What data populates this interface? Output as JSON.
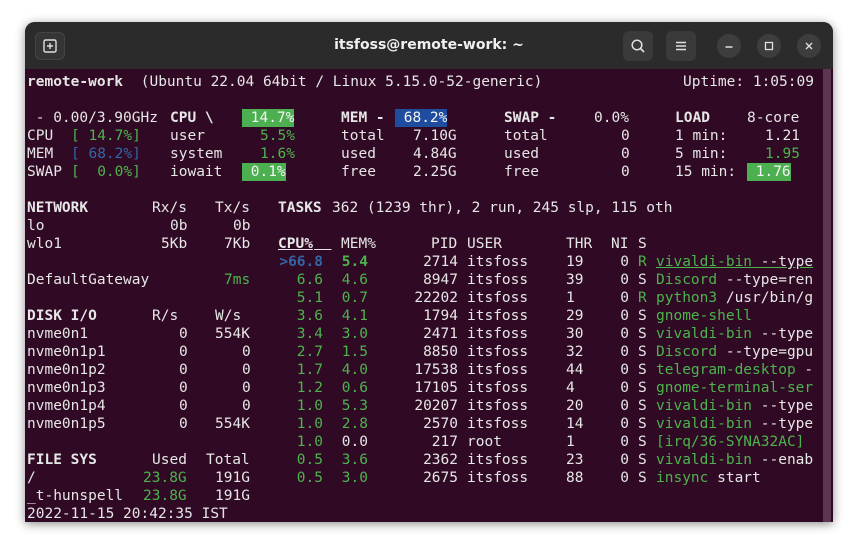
{
  "window": {
    "title": "itsfoss@remote-work: ~"
  },
  "header": {
    "host": "remote-work",
    "os": " (Ubuntu 22.04 64bit / Linux 5.15.0-52-generic)",
    "uptime": "Uptime: 1:05:09"
  },
  "quicklook": {
    "freq": " - 0.00/3.90GHz",
    "cpu_label": "CPU",
    "cpu_val": "[ 14.7%]",
    "mem_label": "MEM",
    "mem_val": "[ 68.2%]",
    "swap_label": "SWAP",
    "swap_val": "[  0.0%]"
  },
  "cpu": {
    "title": "CPU \\",
    "pct": " 14.7%",
    "user_label": "user",
    "user": "5.5%",
    "system_label": "system",
    "system": "1.6%",
    "iowait_label": "iowait",
    "iowait": " 0.1%"
  },
  "mem": {
    "title": "MEM -",
    "pct": " 68.2%",
    "total_label": "total",
    "total": "7.10G",
    "used_label": "used",
    "used": "4.84G",
    "free_label": "free",
    "free": "2.25G"
  },
  "swap": {
    "title": "SWAP -",
    "pct": "0.0%",
    "total_label": "total",
    "total": "0",
    "used_label": "used",
    "used": "0",
    "free_label": "free",
    "free": "0"
  },
  "load": {
    "title": "LOAD",
    "cores": "8-core",
    "m1_label": "1 min:",
    "m1": "1.21",
    "m5_label": "5 min:",
    "m5": "1.95",
    "m15_label": "15 min:",
    "m15": " 1.76"
  },
  "network": {
    "title": "NETWORK",
    "rx_h": "Rx/s",
    "tx_h": "Tx/s",
    "rows": [
      {
        "name": "lo",
        "rx": "0b",
        "tx": "0b"
      },
      {
        "name": "wlo1",
        "rx": "5Kb",
        "tx": "7Kb"
      }
    ],
    "gw_label": "DefaultGateway",
    "gw_val": "7ms"
  },
  "diskio": {
    "title": "DISK I/O",
    "r_h": "R/s",
    "w_h": "W/s",
    "rows": [
      {
        "name": "nvme0n1",
        "r": "0",
        "w": "554K"
      },
      {
        "name": "nvme0n1p1",
        "r": "0",
        "w": "0"
      },
      {
        "name": "nvme0n1p2",
        "r": "0",
        "w": "0"
      },
      {
        "name": "nvme0n1p3",
        "r": "0",
        "w": "0"
      },
      {
        "name": "nvme0n1p4",
        "r": "0",
        "w": "0"
      },
      {
        "name": "nvme0n1p5",
        "r": "0",
        "w": "554K"
      }
    ]
  },
  "fs": {
    "title": "FILE SYS",
    "used_h": "Used",
    "total_h": "Total",
    "rows": [
      {
        "name": "/",
        "used": "23.8G",
        "total": "191G"
      },
      {
        "name": "_t-hunspell",
        "used": "23.8G",
        "total": "191G"
      }
    ]
  },
  "datetime": "2022-11-15 20:42:35 IST",
  "tasks": {
    "label": "TASKS",
    "summary": "362 (1239 thr), 2 run, 245 slp, 115 oth"
  },
  "proc_headers": {
    "cpu": "CPU%",
    "mem": "MEM%",
    "pid": "PID",
    "user": "USER",
    "thr": "THR",
    "ni": "NI",
    "s": "S"
  },
  "processes": [
    {
      "cpu": ">66.8",
      "mem": "5.4",
      "pid": "2714",
      "user": "itsfoss",
      "thr": "19",
      "ni": "0",
      "s": "R",
      "cmd": "vivaldi-bin",
      "args": " --type"
    },
    {
      "cpu": "6.6",
      "mem": "4.6",
      "pid": "8947",
      "user": "itsfoss",
      "thr": "39",
      "ni": "0",
      "s": "S",
      "cmd": "Discord",
      "args": " --type=ren"
    },
    {
      "cpu": "5.1",
      "mem": "0.7",
      "pid": "22202",
      "user": "itsfoss",
      "thr": "1",
      "ni": "0",
      "s": "R",
      "cmd": "python3",
      "args": " /usr/bin/g"
    },
    {
      "cpu": "3.6",
      "mem": "4.1",
      "pid": "1794",
      "user": "itsfoss",
      "thr": "29",
      "ni": "0",
      "s": "S",
      "cmd": "gnome-shell",
      "args": ""
    },
    {
      "cpu": "3.4",
      "mem": "3.0",
      "pid": "2471",
      "user": "itsfoss",
      "thr": "30",
      "ni": "0",
      "s": "S",
      "cmd": "vivaldi-bin",
      "args": " --type"
    },
    {
      "cpu": "2.7",
      "mem": "1.5",
      "pid": "8850",
      "user": "itsfoss",
      "thr": "32",
      "ni": "0",
      "s": "S",
      "cmd": "Discord",
      "args": " --type=gpu"
    },
    {
      "cpu": "1.7",
      "mem": "4.0",
      "pid": "17538",
      "user": "itsfoss",
      "thr": "44",
      "ni": "0",
      "s": "S",
      "cmd": "telegram-desktop",
      "args": " -"
    },
    {
      "cpu": "1.2",
      "mem": "0.6",
      "pid": "17105",
      "user": "itsfoss",
      "thr": "4",
      "ni": "0",
      "s": "S",
      "cmd": "gnome-terminal-ser",
      "args": ""
    },
    {
      "cpu": "1.0",
      "mem": "5.3",
      "pid": "20207",
      "user": "itsfoss",
      "thr": "20",
      "ni": "0",
      "s": "S",
      "cmd": "vivaldi-bin",
      "args": " --type"
    },
    {
      "cpu": "1.0",
      "mem": "2.8",
      "pid": "2570",
      "user": "itsfoss",
      "thr": "14",
      "ni": "0",
      "s": "S",
      "cmd": "vivaldi-bin",
      "args": " --type"
    },
    {
      "cpu": "1.0",
      "mem": "0.0",
      "pid": "217",
      "user": "root",
      "thr": "1",
      "ni": "0",
      "s": "S",
      "cmd": "[irq/36-SYNA32AC]",
      "args": ""
    },
    {
      "cpu": "0.5",
      "mem": "3.6",
      "pid": "2362",
      "user": "itsfoss",
      "thr": "23",
      "ni": "0",
      "s": "S",
      "cmd": "vivaldi-bin",
      "args": " --enab"
    },
    {
      "cpu": "0.5",
      "mem": "3.0",
      "pid": "2675",
      "user": "itsfoss",
      "thr": "88",
      "ni": "0",
      "s": "S",
      "cmd": "insync",
      "args": " start"
    }
  ],
  "colors": {
    "terminal_bg": "#300a24",
    "titlebar_bg": "#2b2b2b",
    "green": "#4db34d",
    "blue": "#3465a4",
    "green_highlight": "#4caf50",
    "blue_highlight": "#1e4da0"
  },
  "icons": {
    "new_tab": "new-tab-icon",
    "search": "search-icon",
    "menu": "hamburger-menu-icon",
    "minimize": "minimize-icon",
    "maximize": "maximize-icon",
    "close": "close-icon"
  }
}
